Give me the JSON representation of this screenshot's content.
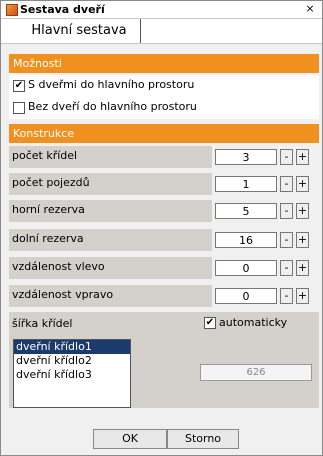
{
  "window": {
    "title": "Sestava dveří",
    "close_glyph": "×"
  },
  "tabs": [
    {
      "label": "Hlavní sestava"
    }
  ],
  "options": {
    "header": "Možnosti",
    "items": [
      {
        "label": "S dveřmi do hlavního prostoru",
        "checked": true,
        "mark": "✔"
      },
      {
        "label": "Bez dveří do hlavního prostoru",
        "checked": false,
        "mark": ""
      }
    ]
  },
  "construction": {
    "header": "Konstrukce",
    "params": [
      {
        "label": "počet křídel",
        "value": "3"
      },
      {
        "label": "počet pojezdů",
        "value": "1"
      },
      {
        "label": "horní rezerva",
        "value": "5"
      },
      {
        "label": "dolní rezerva",
        "value": "16"
      },
      {
        "label": "vzdálenost vlevo",
        "value": "0"
      },
      {
        "label": "vzdálenost vpravo",
        "value": "0"
      }
    ],
    "minus_label": "-",
    "plus_label": "+"
  },
  "wing_width": {
    "label": "šířka křídel",
    "auto_label": "automaticky",
    "auto_checked": true,
    "auto_mark": "✔",
    "list": [
      "dveřní křídlo1",
      "dveřní křídlo2",
      "dveřní křídlo3"
    ],
    "selected_index": 0,
    "value": "626"
  },
  "footer": {
    "ok_label": "OK",
    "cancel_label": "Storno"
  },
  "colors": {
    "section_header": "#f0901e",
    "selected_item": "#1c3a6e",
    "param_label_bg": "#d4d0cb"
  },
  "icons": {
    "app": "door-app-icon",
    "close": "close-icon",
    "checkbox_checked": "checkmark-icon"
  }
}
